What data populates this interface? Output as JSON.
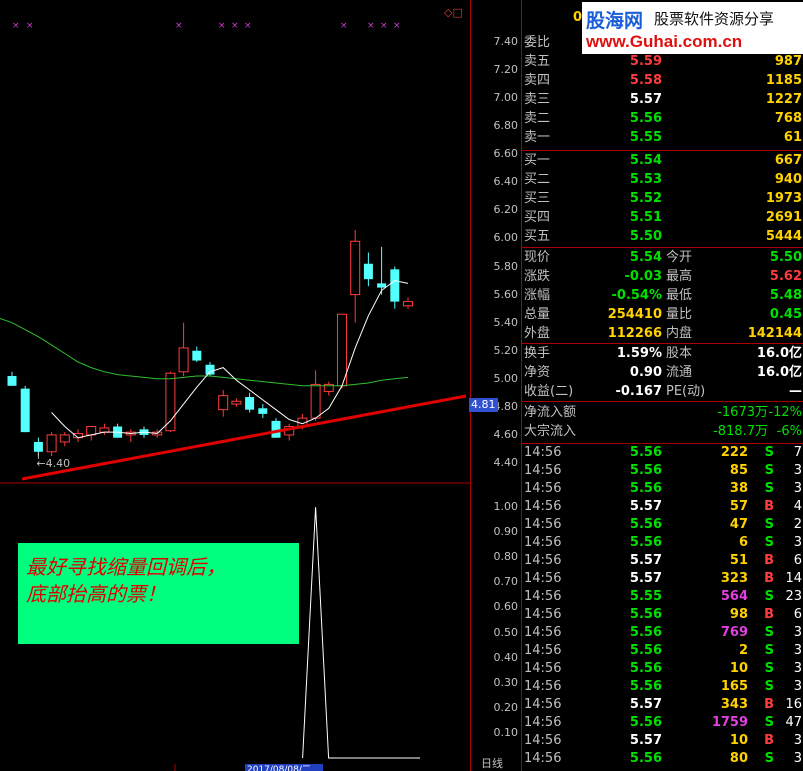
{
  "chart": {
    "price_ticks": [
      "7.40",
      "7.20",
      "7.00",
      "6.80",
      "6.60",
      "6.40",
      "6.20",
      "6.00",
      "5.80",
      "5.60",
      "5.40",
      "5.20",
      "5.00",
      "4.80",
      "4.60",
      "4.40"
    ],
    "current_price_tag": "4.81",
    "low_label": "4.40",
    "vol_ticks": [
      "1.00",
      "0.90",
      "0.80",
      "0.70",
      "0.60",
      "0.50",
      "0.40",
      "0.30",
      "0.20",
      "0.10"
    ],
    "date_label": "2017/08/08/二",
    "corner_icons": "◇□",
    "bottom_right_label": "日线",
    "colors": {
      "up": "#ff3c3c",
      "down": "#54ffff",
      "ma_white": "#ffffff",
      "ma_green": "#2fbf2f",
      "trend": "#e00000"
    }
  },
  "chart_data": {
    "type": "candlestick",
    "ylim": [
      4.3,
      7.45
    ],
    "candles": [
      {
        "o": 5.02,
        "h": 5.05,
        "l": 4.95,
        "c": 4.95
      },
      {
        "o": 4.93,
        "h": 4.95,
        "l": 4.62,
        "c": 4.62
      },
      {
        "o": 4.55,
        "h": 4.58,
        "l": 4.45,
        "c": 4.48
      },
      {
        "o": 4.48,
        "h": 4.62,
        "l": 4.45,
        "c": 4.6
      },
      {
        "o": 4.55,
        "h": 4.62,
        "l": 4.52,
        "c": 4.6
      },
      {
        "o": 4.58,
        "h": 4.64,
        "l": 4.55,
        "c": 4.61
      },
      {
        "o": 4.6,
        "h": 4.66,
        "l": 4.56,
        "c": 4.66
      },
      {
        "o": 4.62,
        "h": 4.68,
        "l": 4.6,
        "c": 4.65
      },
      {
        "o": 4.66,
        "h": 4.68,
        "l": 4.58,
        "c": 4.58
      },
      {
        "o": 4.6,
        "h": 4.64,
        "l": 4.55,
        "c": 4.62
      },
      {
        "o": 4.64,
        "h": 4.66,
        "l": 4.58,
        "c": 4.6
      },
      {
        "o": 4.6,
        "h": 4.64,
        "l": 4.58,
        "c": 4.62
      },
      {
        "o": 4.63,
        "h": 5.05,
        "l": 4.62,
        "c": 5.04
      },
      {
        "o": 5.05,
        "h": 5.4,
        "l": 5.02,
        "c": 5.22
      },
      {
        "o": 5.2,
        "h": 5.23,
        "l": 5.12,
        "c": 5.13
      },
      {
        "o": 5.1,
        "h": 5.12,
        "l": 5.02,
        "c": 5.03
      },
      {
        "o": 4.78,
        "h": 4.92,
        "l": 4.73,
        "c": 4.88
      },
      {
        "o": 4.82,
        "h": 4.86,
        "l": 4.8,
        "c": 4.84
      },
      {
        "o": 4.87,
        "h": 4.9,
        "l": 4.76,
        "c": 4.78
      },
      {
        "o": 4.79,
        "h": 4.82,
        "l": 4.72,
        "c": 4.75
      },
      {
        "o": 4.7,
        "h": 4.72,
        "l": 4.58,
        "c": 4.58
      },
      {
        "o": 4.6,
        "h": 4.68,
        "l": 4.56,
        "c": 4.66
      },
      {
        "o": 4.66,
        "h": 4.75,
        "l": 4.64,
        "c": 4.72
      },
      {
        "o": 4.72,
        "h": 5.06,
        "l": 4.7,
        "c": 4.96
      },
      {
        "o": 4.91,
        "h": 4.98,
        "l": 4.88,
        "c": 4.96
      },
      {
        "o": 4.95,
        "h": 5.46,
        "l": 4.93,
        "c": 5.46
      },
      {
        "o": 5.6,
        "h": 6.06,
        "l": 5.4,
        "c": 5.98
      },
      {
        "o": 5.82,
        "h": 5.9,
        "l": 5.66,
        "c": 5.71
      },
      {
        "o": 5.68,
        "h": 5.94,
        "l": 5.6,
        "c": 5.65
      },
      {
        "o": 5.78,
        "h": 5.8,
        "l": 5.5,
        "c": 5.55
      },
      {
        "o": 5.52,
        "h": 5.58,
        "l": 5.5,
        "c": 5.55
      }
    ],
    "ma_white": [
      null,
      null,
      null,
      4.76,
      4.66,
      4.58,
      4.6,
      4.62,
      4.62,
      4.61,
      4.62,
      4.61,
      4.7,
      4.82,
      4.94,
      5.05,
      5.08,
      4.99,
      4.92,
      4.85,
      4.78,
      4.71,
      4.68,
      4.72,
      4.79,
      4.95,
      5.22,
      5.45,
      5.63,
      5.7,
      5.68
    ],
    "ma_green": [
      5.4,
      5.35,
      5.3,
      5.24,
      5.18,
      5.12,
      5.08,
      5.05,
      5.03,
      5.02,
      5.01,
      5.0,
      5.0,
      5.01,
      5.02,
      5.02,
      5.01,
      5.0,
      4.99,
      4.98,
      4.97,
      4.96,
      4.95,
      4.95,
      4.95,
      4.95,
      4.96,
      4.97,
      4.99,
      5.0,
      5.01
    ],
    "volume_ylim": [
      0,
      1.08
    ],
    "volume_spike": {
      "candle_index": 23,
      "value": 1.0
    }
  },
  "quote": {
    "header_value": "0",
    "wei_bi_label": "委比",
    "asks": [
      {
        "label": "卖五",
        "price": "5.59",
        "vol": "987"
      },
      {
        "label": "卖四",
        "price": "5.58",
        "vol": "1185"
      },
      {
        "label": "卖三",
        "price": "5.57",
        "vol": "1227"
      },
      {
        "label": "卖二",
        "price": "5.56",
        "vol": "768"
      },
      {
        "label": "卖一",
        "price": "5.55",
        "vol": "61"
      }
    ],
    "bids": [
      {
        "label": "买一",
        "price": "5.54",
        "vol": "667"
      },
      {
        "label": "买二",
        "price": "5.53",
        "vol": "940"
      },
      {
        "label": "买三",
        "price": "5.52",
        "vol": "1973"
      },
      {
        "label": "买四",
        "price": "5.51",
        "vol": "2691"
      },
      {
        "label": "买五",
        "price": "5.50",
        "vol": "5444"
      }
    ],
    "stats": [
      {
        "l1": "现价",
        "v1": "5.54",
        "l2": "今开",
        "v2": "5.50"
      },
      {
        "l1": "涨跌",
        "v1": "-0.03",
        "l2": "最高",
        "v2": "5.62"
      },
      {
        "l1": "涨幅",
        "v1": "-0.54%",
        "l2": "最低",
        "v2": "5.48"
      },
      {
        "l1": "总量",
        "v1": "254410",
        "l2": "量比",
        "v2": "0.45"
      },
      {
        "l1": "外盘",
        "v1": "112266",
        "l2": "内盘",
        "v2": "142144"
      }
    ],
    "fund": [
      {
        "l1": "换手",
        "v1": "1.59%",
        "l2": "股本",
        "v2": "16.0亿"
      },
      {
        "l1": "净资",
        "v1": "0.90",
        "l2": "流通",
        "v2": "16.0亿"
      },
      {
        "l1": "收益(二)",
        "v1": "-0.167",
        "l2": "PE(动)",
        "v2": "—"
      }
    ],
    "flow": [
      {
        "l": "净流入额",
        "v": "-1673万",
        "p": "-12%"
      },
      {
        "l": "大宗流入",
        "v": "-818.7万",
        "p": "-6%"
      }
    ]
  },
  "trades": [
    {
      "t": "14:56",
      "p": "5.56",
      "v": "222",
      "s": "S",
      "n": "7"
    },
    {
      "t": "14:56",
      "p": "5.56",
      "v": "85",
      "s": "S",
      "n": "3"
    },
    {
      "t": "14:56",
      "p": "5.56",
      "v": "38",
      "s": "S",
      "n": "3"
    },
    {
      "t": "14:56",
      "p": "5.57",
      "v": "57",
      "s": "B",
      "n": "4"
    },
    {
      "t": "14:56",
      "p": "5.56",
      "v": "47",
      "s": "S",
      "n": "2"
    },
    {
      "t": "14:56",
      "p": "5.56",
      "v": "6",
      "s": "S",
      "n": "3"
    },
    {
      "t": "14:56",
      "p": "5.57",
      "v": "51",
      "s": "B",
      "n": "6"
    },
    {
      "t": "14:56",
      "p": "5.57",
      "v": "323",
      "s": "B",
      "n": "14"
    },
    {
      "t": "14:56",
      "p": "5.55",
      "v": "564",
      "s": "S",
      "n": "23"
    },
    {
      "t": "14:56",
      "p": "5.56",
      "v": "98",
      "s": "B",
      "n": "6"
    },
    {
      "t": "14:56",
      "p": "5.56",
      "v": "769",
      "s": "S",
      "n": "3"
    },
    {
      "t": "14:56",
      "p": "5.56",
      "v": "2",
      "s": "S",
      "n": "3"
    },
    {
      "t": "14:56",
      "p": "5.56",
      "v": "10",
      "s": "S",
      "n": "3"
    },
    {
      "t": "14:56",
      "p": "5.56",
      "v": "165",
      "s": "S",
      "n": "3"
    },
    {
      "t": "14:56",
      "p": "5.57",
      "v": "343",
      "s": "B",
      "n": "16"
    },
    {
      "t": "14:56",
      "p": "5.56",
      "v": "1759",
      "s": "S",
      "n": "47"
    },
    {
      "t": "14:56",
      "p": "5.57",
      "v": "10",
      "s": "B",
      "n": "3"
    },
    {
      "t": "14:56",
      "p": "5.56",
      "v": "80",
      "s": "S",
      "n": "3"
    }
  ],
  "logo": {
    "line1": "股海网",
    "line2": "股票软件资源分享",
    "line3": "www.Guhai.com.cn"
  },
  "note": {
    "line1": "最好寻找缩量回调后，",
    "line2": "底部抬高的票！"
  }
}
